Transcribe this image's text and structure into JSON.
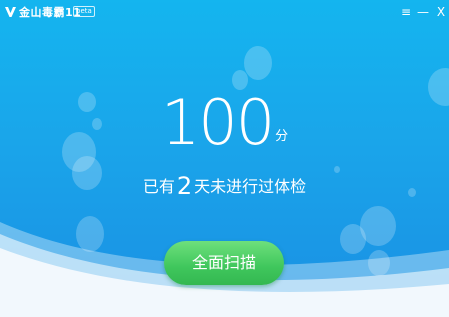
{
  "window": {
    "title": "金山毒霸11",
    "beta_badge": "beta",
    "controls": {
      "menu": "≡",
      "minimize": "—",
      "close": "X"
    }
  },
  "score": {
    "value": "100",
    "unit": "分"
  },
  "status": {
    "prefix": "已有",
    "days": "2",
    "suffix": "天未进行过体检"
  },
  "scan_button": {
    "label": "全面扫描"
  },
  "colors": {
    "background": "#1aa5ea",
    "button": "#3fc65c",
    "text": "#ffffff"
  }
}
